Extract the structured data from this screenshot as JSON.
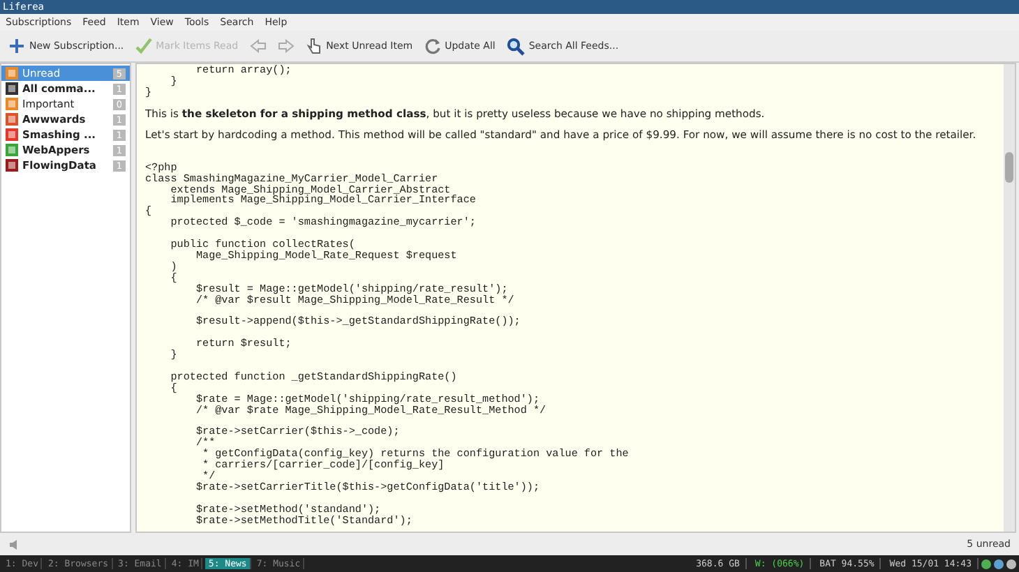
{
  "window": {
    "title": "Liferea"
  },
  "menu": [
    "Subscriptions",
    "Feed",
    "Item",
    "View",
    "Tools",
    "Search",
    "Help"
  ],
  "toolbar": [
    {
      "kind": "add",
      "label": "New Subscription...",
      "disabled": false
    },
    {
      "kind": "check",
      "label": "Mark Items Read",
      "disabled": true
    },
    {
      "kind": "back",
      "disabled": true
    },
    {
      "kind": "forward",
      "disabled": true
    },
    {
      "kind": "next",
      "label": "Next Unread Item",
      "disabled": false
    },
    {
      "kind": "refresh",
      "label": "Update All",
      "disabled": false
    },
    {
      "kind": "search",
      "label": "Search All Feeds...",
      "disabled": false
    }
  ],
  "sidebar": {
    "items": [
      {
        "label": "Unread",
        "count": "5",
        "selected": true,
        "bold": false
      },
      {
        "label": "All comma...",
        "count": "1",
        "selected": false,
        "bold": true
      },
      {
        "label": "Important",
        "count": "0",
        "selected": false,
        "bold": false
      },
      {
        "label": "Awwwards",
        "count": "1",
        "selected": false,
        "bold": true
      },
      {
        "label": "Smashing ...",
        "count": "1",
        "selected": false,
        "bold": true
      },
      {
        "label": "WebAppers",
        "count": "1",
        "selected": false,
        "bold": true
      },
      {
        "label": "FlowingData",
        "count": "1",
        "selected": false,
        "bold": true
      }
    ]
  },
  "article": {
    "code_top": "        return array();\n    }\n}",
    "paragraphs": [
      "This is **the skeleton for a shipping method class**, but it is pretty useless because we have no shipping methods.",
      "Let's start by hardcoding a method. This method will be called \"standard\" and have a price of $9.99. For now, we will assume there is no cost to the retailer."
    ],
    "code": "<?php\nclass SmashingMagazine_MyCarrier_Model_Carrier\n    extends Mage_Shipping_Model_Carrier_Abstract\n    implements Mage_Shipping_Model_Carrier_Interface\n{\n    protected $_code = 'smashingmagazine_mycarrier';\n\n    public function collectRates(\n        Mage_Shipping_Model_Rate_Request $request\n    )\n    {\n        $result = Mage::getModel('shipping/rate_result');\n        /* @var $result Mage_Shipping_Model_Rate_Result */\n\n        $result->append($this->_getStandardShippingRate());\n\n        return $result;\n    }\n\n    protected function _getStandardShippingRate()\n    {\n        $rate = Mage::getModel('shipping/rate_result_method');\n        /* @var $rate Mage_Shipping_Model_Rate_Result_Method */\n\n        $rate->setCarrier($this->_code);\n        /**\n         * getConfigData(config_key) returns the configuration value for the\n         * carriers/[carrier_code]/[config_key]\n         */\n        $rate->setCarrierTitle($this->getConfigData('title'));\n\n        $rate->setMethod('standand');\n        $rate->setMethodTitle('Standard');"
  },
  "status_bar": {
    "text": "5 unread"
  },
  "taskbar": {
    "workspaces": [
      {
        "label": "1: Dev",
        "selected": false
      },
      {
        "label": "2: Browsers",
        "selected": false
      },
      {
        "label": "3: Email",
        "selected": false
      },
      {
        "label": "4: IM",
        "selected": false
      },
      {
        "label": "5: News",
        "selected": true
      },
      {
        "label": "7: Music",
        "selected": false
      }
    ],
    "disk": "368.6 GB",
    "wifi": "W: (066%)",
    "battery": "BAT 94.55%",
    "clock": "Wed 15/01 14:43"
  }
}
